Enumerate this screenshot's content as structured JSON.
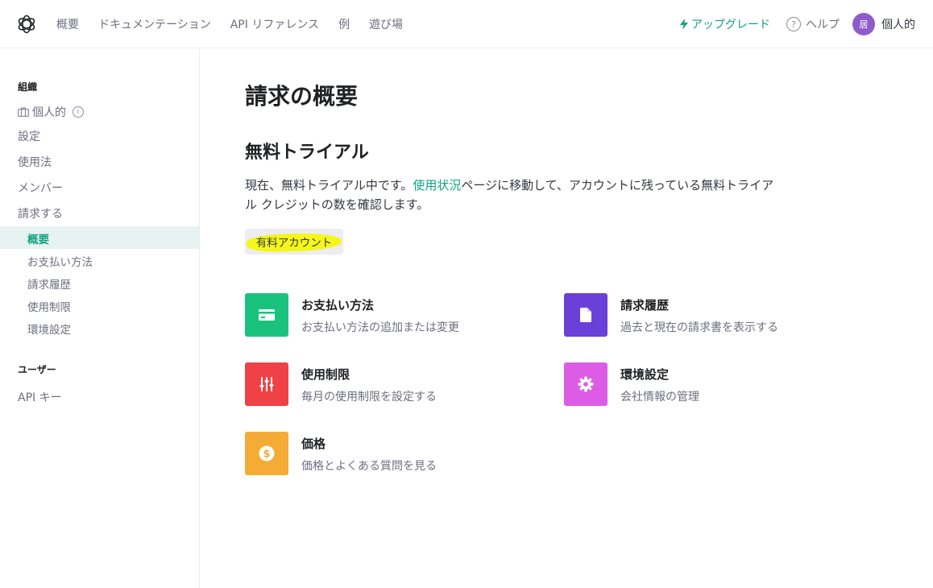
{
  "topnav": {
    "items": [
      "概要",
      "ドキュメンテーション",
      "API リファレンス",
      "例",
      "遊び場"
    ],
    "upgrade": "アップグレード",
    "help": "ヘルプ",
    "avatar_initial": "居",
    "user_label": "個人的"
  },
  "sidebar": {
    "org_heading": "組織",
    "org_name": "個人的",
    "items": [
      "設定",
      "使用法",
      "メンバー",
      "請求する"
    ],
    "billing_sub": [
      "概要",
      "お支払い方法",
      "請求履歴",
      "使用制限",
      "環境設定"
    ],
    "user_heading": "ユーザー",
    "api_keys": "API キー"
  },
  "main": {
    "title": "請求の概要",
    "section_title": "無料トライアル",
    "desc_before": "現在、無料トライアル中です。",
    "desc_link": "使用状況",
    "desc_after": "ページに移動して、アカウントに残っている無料トライアル クレジットの数を確認します。",
    "paid_button": "有料アカウント",
    "cards": [
      {
        "title": "お支払い方法",
        "sub": "お支払い方法の追加または変更",
        "icon": "credit-card-icon",
        "color": "#19c37d"
      },
      {
        "title": "請求履歴",
        "sub": "過去と現在の請求書を表示する",
        "icon": "document-icon",
        "color": "#6b40d8"
      },
      {
        "title": "使用制限",
        "sub": "毎月の使用制限を設定する",
        "icon": "sliders-icon",
        "color": "#ef4146"
      },
      {
        "title": "環境設定",
        "sub": "会社情報の管理",
        "icon": "gear-icon",
        "color": "#dd5ce5"
      },
      {
        "title": "価格",
        "sub": "価格とよくある質問を見る",
        "icon": "dollar-icon",
        "color": "#f4ac36"
      }
    ]
  }
}
